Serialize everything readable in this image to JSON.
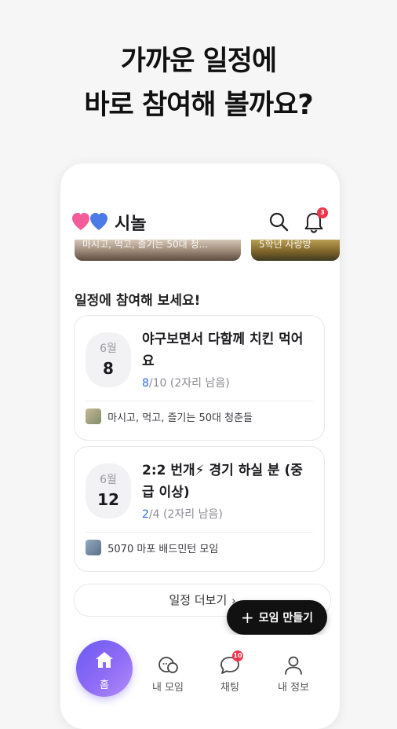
{
  "headline": {
    "line1": "가까운 일정에",
    "line2": "바로 참여해 볼까요?"
  },
  "app": {
    "title": "시놀",
    "notification_count": "3"
  },
  "carousel": [
    {
      "caption": "마시고, 먹고, 즐기는 50대 청..."
    },
    {
      "caption": "5학년 사랑방"
    }
  ],
  "section_title": "일정에 참여해 보세요!",
  "events": [
    {
      "month": "6월",
      "day": "8",
      "title": "야구보면서 다함께 치킨 먹어요",
      "cap_current": "8",
      "cap_rest": "/10 (2자리 남음)",
      "group_name": "마시고, 먹고, 즐기는 50대 청춘들"
    },
    {
      "month": "6월",
      "day": "12",
      "title": "2:2 번개⚡ 경기 하실 분 (중급 이상)",
      "cap_current": "2",
      "cap_rest": "/4 (2자리 남음)",
      "group_name": "5070 마포  배드민턴 모임"
    }
  ],
  "more_button": "일정 더보기",
  "fab_label": "모임 만들기",
  "tabs": {
    "home": "홈",
    "my_groups": "내 모임",
    "chat": "채팅",
    "chat_badge": "10",
    "my_info": "내 정보"
  },
  "colors": {
    "accent": "#2f6fe3",
    "badge": "#f0344b",
    "home_tab": "#7b63f5"
  }
}
